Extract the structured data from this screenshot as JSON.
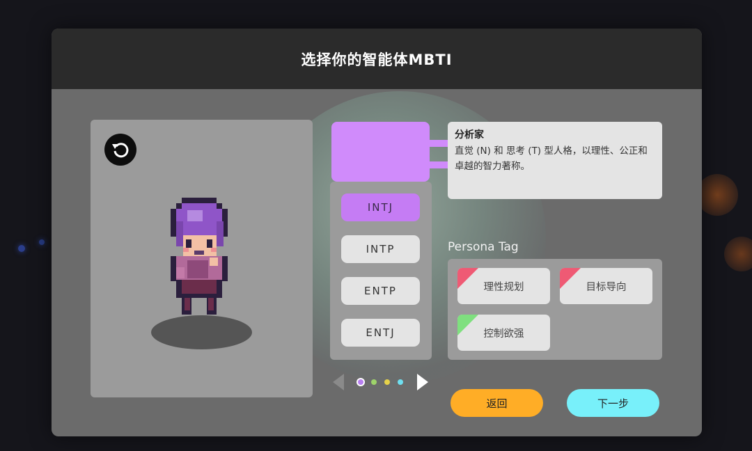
{
  "dialog": {
    "title": "选择你的智能体MBTI"
  },
  "preview": {
    "reset_icon": "rotate-ccw-icon"
  },
  "mbti": {
    "selected_color": "#d08bfb",
    "types": [
      {
        "label": "INTJ",
        "selected": true
      },
      {
        "label": "INTP",
        "selected": false
      },
      {
        "label": "ENTP",
        "selected": false
      },
      {
        "label": "ENTJ",
        "selected": false
      }
    ]
  },
  "description": {
    "title": "分析家",
    "text": "直觉 (N) 和 思考 (T) 型人格，以理性、公正和卓越的智力著称。"
  },
  "persona": {
    "title": "Persona Tag",
    "tags": [
      {
        "label": "理性规划",
        "color": "#ef5a74"
      },
      {
        "label": "目标导向",
        "color": "#ef5a74"
      },
      {
        "label": "控制欲强",
        "color": "#7fe07f"
      }
    ]
  },
  "pager": {
    "prev_icon": "chevron-left-icon",
    "next_icon": "chevron-right-icon",
    "dots": [
      {
        "color": "#b77ef0",
        "active": true
      },
      {
        "color": "#9ed36a",
        "active": false
      },
      {
        "color": "#e6d24a",
        "active": false
      },
      {
        "color": "#6fdff0",
        "active": false
      }
    ]
  },
  "actions": {
    "back_label": "返回",
    "back_color": "#ffad26",
    "next_label": "下一步",
    "next_color": "#78f0fa"
  }
}
